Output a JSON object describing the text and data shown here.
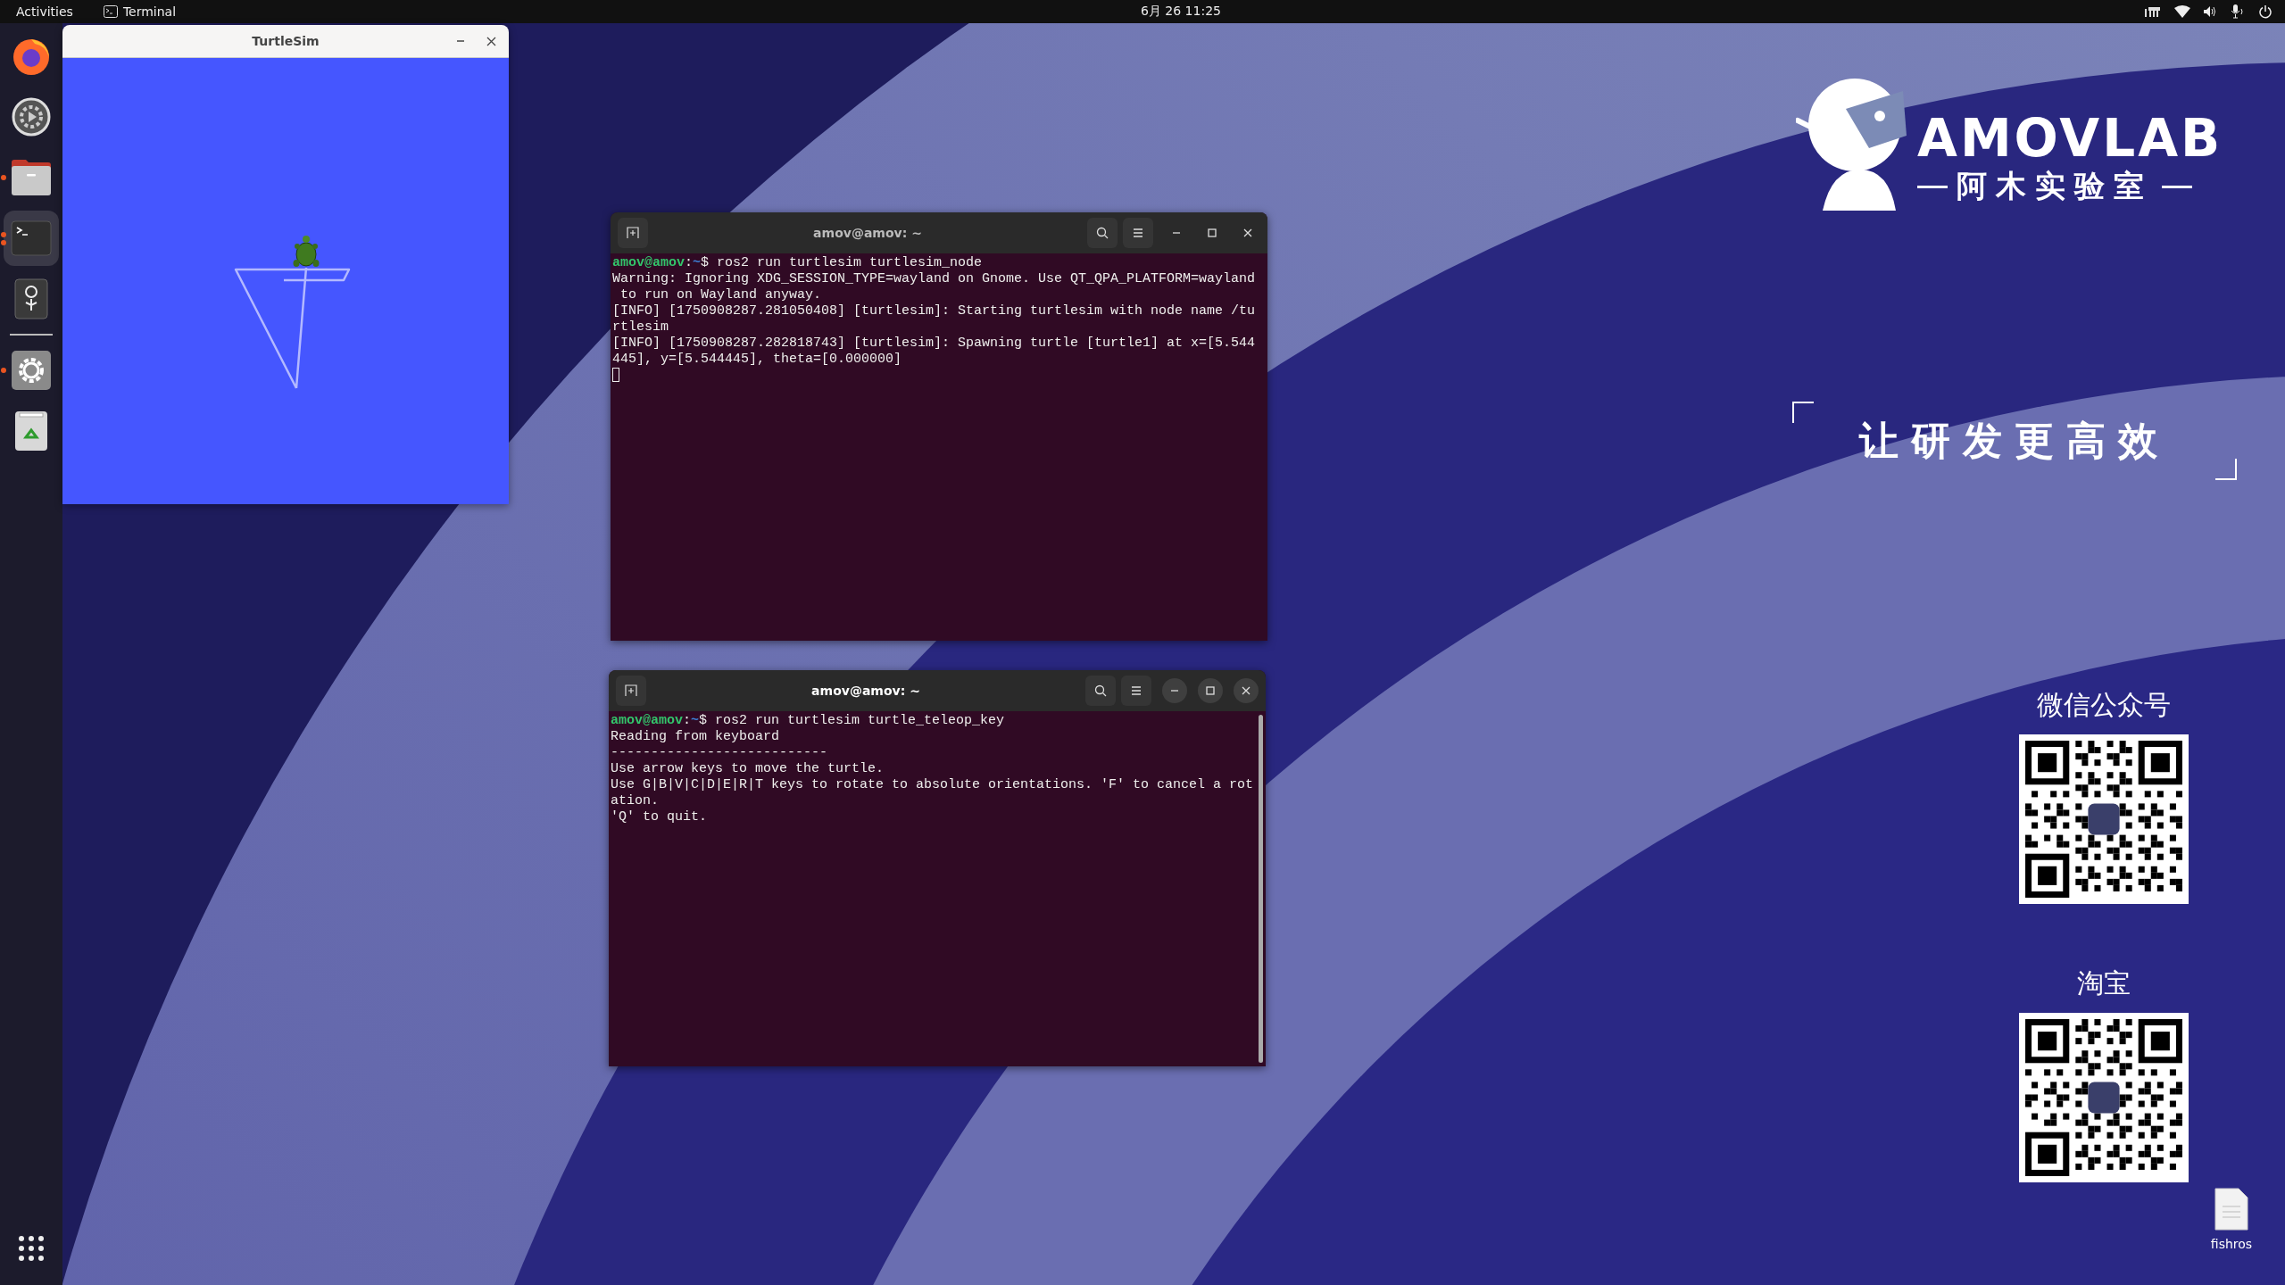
{
  "top_bar": {
    "activities": "Activities",
    "app_menu": "Terminal",
    "clock": "6月 26 11:25"
  },
  "dock": {
    "items": [
      {
        "kind": "firefox",
        "running": false,
        "selected": false
      },
      {
        "kind": "updater",
        "running": false,
        "selected": false
      },
      {
        "kind": "files",
        "running": true,
        "multiple_windows": false,
        "selected": false
      },
      {
        "kind": "terminal",
        "running": true,
        "multiple_windows": true,
        "selected": true
      },
      {
        "kind": "pin",
        "running": false,
        "selected": false
      },
      {
        "kind": "separator"
      },
      {
        "kind": "settings",
        "running": true,
        "multiple_windows": false,
        "selected": false
      },
      {
        "kind": "trash",
        "running": false,
        "selected": false
      }
    ]
  },
  "turtlesim_window": {
    "title": "TurtleSim"
  },
  "terminals": [
    {
      "title": "amov@amov: ~",
      "focused": false,
      "cursor": true,
      "lines": [
        {
          "kind": "prompt",
          "user": "amov@amov",
          "separator": ":",
          "path": "~",
          "symbol": "$",
          "command": " ros2 run turtlesim turtlesim_node"
        },
        {
          "kind": "output",
          "text": "Warning: Ignoring XDG_SESSION_TYPE=wayland on Gnome. Use QT_QPA_PLATFORM=wayland"
        },
        {
          "kind": "output",
          "text": " to run on Wayland anyway."
        },
        {
          "kind": "output",
          "text": "[INFO] [1750908287.281050408] [turtlesim]: Starting turtlesim with node name /tu"
        },
        {
          "kind": "output",
          "text": "rtlesim"
        },
        {
          "kind": "output",
          "text": "[INFO] [1750908287.282818743] [turtlesim]: Spawning turtle [turtle1] at x=[5.544"
        },
        {
          "kind": "output",
          "text": "445], y=[5.544445], theta=[0.000000]"
        }
      ]
    },
    {
      "title": "amov@amov: ~",
      "focused": true,
      "cursor": false,
      "lines": [
        {
          "kind": "prompt",
          "user": "amov@amov",
          "separator": ":",
          "path": "~",
          "symbol": "$",
          "command": " ros2 run turtlesim turtle_teleop_key"
        },
        {
          "kind": "output",
          "text": "Reading from keyboard"
        },
        {
          "kind": "output",
          "text": "---------------------------"
        },
        {
          "kind": "output",
          "text": "Use arrow keys to move the turtle."
        },
        {
          "kind": "output",
          "text": "Use G|B|V|C|D|E|R|T keys to rotate to absolute orientations. 'F' to cancel a rot"
        },
        {
          "kind": "output",
          "text": "ation."
        },
        {
          "kind": "output",
          "text": "'Q' to quit."
        }
      ]
    }
  ],
  "wallpaper": {
    "brand": "AMOVLAB",
    "brand_cn": "阿木实验室",
    "slogan": "让研发更高效",
    "qr_codes": [
      {
        "label": "微信公众号"
      },
      {
        "label": "淘宝"
      }
    ]
  },
  "desktop_icons": [
    {
      "label": "fishros"
    }
  ]
}
